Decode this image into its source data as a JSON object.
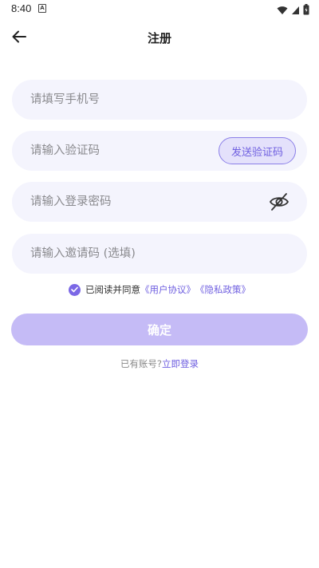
{
  "status_bar": {
    "time": "8:40",
    "notification_glyph": "A",
    "icons": [
      "wifi-icon",
      "signal-icon",
      "battery-icon"
    ]
  },
  "header": {
    "title": "注册",
    "back_icon": "arrow-left-icon"
  },
  "form": {
    "phone_placeholder": "请填写手机号",
    "code_placeholder": "请输入验证码",
    "send_code_label": "发送验证码",
    "password_placeholder": "请输入登录密码",
    "password_toggle_icon": "eye-off-icon",
    "invite_placeholder": "请输入邀请码 (选填)"
  },
  "agreement": {
    "checked": true,
    "text": "已阅读并同意",
    "user_agreement": "《用户协议》",
    "privacy_policy": "《隐私政策》"
  },
  "confirm_label": "确定",
  "login": {
    "prompt": "已有账号?",
    "link": "立即登录"
  },
  "colors": {
    "accent": "#6f5fe0",
    "button_disabled": "#c5bbf6",
    "field_bg": "#f4f4fd"
  }
}
